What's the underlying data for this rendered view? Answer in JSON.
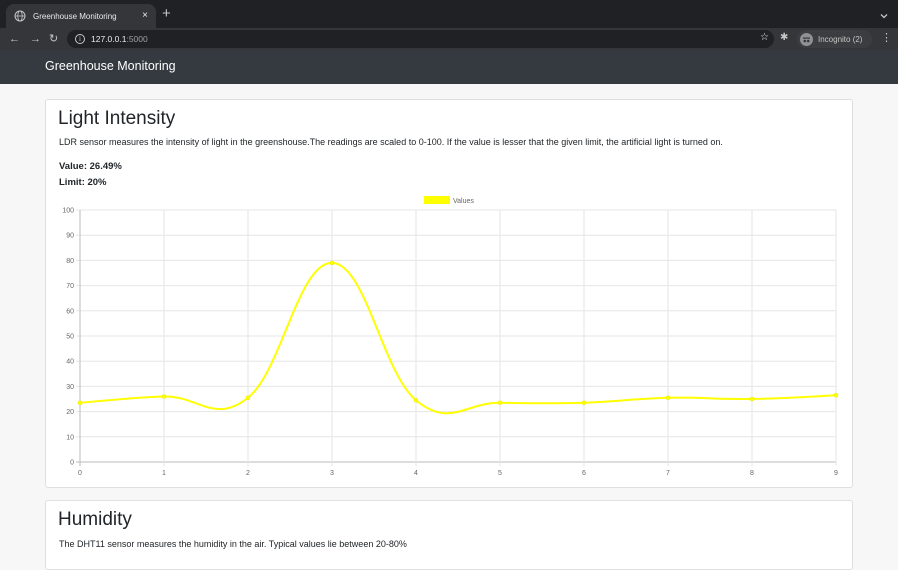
{
  "browser": {
    "tab_title": "Greenhouse Monitoring",
    "tab_close": "×",
    "new_tab": "+",
    "url_host": "127.0.0.1",
    "url_port": ":5000",
    "incognito_label": "Incognito (2)",
    "back": "←",
    "forward": "→",
    "reload": "↻",
    "star": "☆",
    "extensions": "✱",
    "menu": "⋮"
  },
  "navbar": {
    "brand": "Greenhouse Monitoring"
  },
  "light": {
    "title": "Light Intensity",
    "description": "LDR sensor measures the intensity of light in the greenshouse.The readings are scaled to 0-100. If the value is lesser that the given limit, the artificial light is turned on.",
    "value": "Value: 26.49%",
    "limit": "Limit: 20%"
  },
  "humidity": {
    "title": "Humidity",
    "description": "The DHT11 sensor measures the humidity in the air. Typical values lie between 20-80%"
  },
  "colors": {
    "series": "#ffff00",
    "navbar": "#343a40"
  },
  "chart_data": {
    "type": "line",
    "x": [
      0,
      1,
      2,
      3,
      4,
      5,
      6,
      7,
      8,
      9
    ],
    "series": [
      {
        "name": "Values",
        "values": [
          23.5,
          26,
          25.5,
          79,
          24.5,
          23.5,
          23.5,
          25.5,
          25,
          26.49
        ]
      }
    ],
    "ylim": [
      0,
      100
    ],
    "yticks": [
      0,
      10,
      20,
      30,
      40,
      50,
      60,
      70,
      80,
      90,
      100
    ],
    "grid": true,
    "legend": "top-center"
  }
}
